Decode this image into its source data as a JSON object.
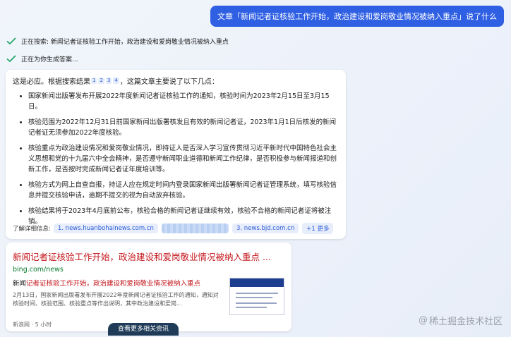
{
  "user_message": "文章「新闻记者证核验工作开始，政治建设和爱岗敬业情况被纳入重点」说了什么",
  "status": [
    {
      "text": "正在搜索: 新闻记者证核验工作开始，政治建设和爱岗敬业情况被纳入重点"
    },
    {
      "text": "正在为你生成答案..."
    }
  ],
  "answer": {
    "intro_before": "这是必应。根据搜索结果",
    "citations": [
      "1",
      "2",
      "3",
      "4"
    ],
    "intro_after": "，这篇文章主要说了以下几点：",
    "points": [
      "国家新闻出版署发布开展2022年度新闻记者证核验工作的通知，核验时间为2023年2月15日至3月15日。",
      "核验范围为2022年12月31日前国家新闻出版署核发且有效的新闻记者证，2023年1月1日后核发的新闻记者证无须参加2022年度核验。",
      "核验重点为政治建设情况和爱岗敬业情况，即持证人是否深入学习宣传贯彻习近平新时代中国特色社会主义思想和党的十九届六中全会精神，是否遵守新闻职业道德和新闻工作纪律，是否积极参与新闻报道和创新工作，是否按时完成新闻记者证年度培训等。",
      "核验方式为网上自查自报，持证人应在规定时间内登录国家新闻出版署新闻记者证管理系统，填写核验信息并提交核验申请，逾期不提交的视为自动放弃核验。",
      "核验结果将于2023年4月底前公布，核验合格的新闻记者证继续有效，核验不合格的新闻记者证将被注销。"
    ],
    "learn_more_label": "了解详细信息:",
    "links": [
      "1. news.huanbohainews.com.cn",
      "",
      "3. news.bjd.com.cn"
    ],
    "more_label": "+1 更多"
  },
  "result": {
    "title": "新闻记者证核验工作开始，政治建设和爱岗敬业情况被纳入重点 ...",
    "url": "bing.com/news",
    "snippet_plain": "新闻",
    "snippet_highlight": "记者证核验工作开始，政治建设和爱岗敬业情况被纳入重点",
    "snippet_body": "2月13日，国家新闻出版署发布开展2022年度新闻记者证核验工作的通知，通知对核验时间、核验范围、核验重点等作出说明，其中政治建设和爱岗...",
    "source": "新浪网 · 5 小时",
    "see_more": "查看更多相关资讯"
  },
  "watermark": "稀土掘金技术社区",
  "colors": {
    "accent": "#2f5fe3",
    "check_green": "#1aa260",
    "result_title": "#c4161c",
    "result_url": "#0a7a2f"
  }
}
